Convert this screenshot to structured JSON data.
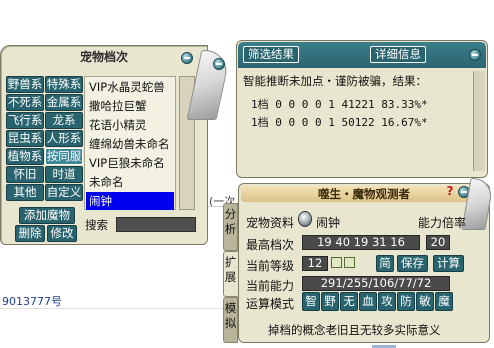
{
  "background": {
    "fragment_text": "(一次",
    "number_text": "9013777号"
  },
  "pet_archive": {
    "title": "宠物档次",
    "categories": [
      "野兽系",
      "特殊系",
      "不死系",
      "金属系",
      "飞行系",
      "龙系",
      "昆虫系",
      "人形系",
      "植物系",
      "按同服",
      "怀旧",
      "时道",
      "其他",
      "自定义"
    ],
    "selected_category": "按同服",
    "pets": [
      "VIP水晶灵蛇兽",
      "撒哈拉巨蟹",
      "花语小精灵",
      "缠绵幼兽未命名",
      "VIP巨狼未命名",
      "未命名",
      "闹钟"
    ],
    "selected_pet": "闹钟",
    "add_button": "添加魔物",
    "delete_button": "删除",
    "modify_button": "修改",
    "search_label": "搜索",
    "search_value": ""
  },
  "results": {
    "filter_button": "筛选结果",
    "detail_button": "详细信息",
    "headline": "智能推断未加点・谨防被骗，结果：",
    "rows": [
      "1档 0 0 0 0 1 41221 83.33%*",
      "1档 0 0 0 0 1 50122 16.67%*"
    ]
  },
  "observer": {
    "title": "噬生・魔物观测者",
    "help_icon": "?",
    "side_tabs": [
      "分析",
      "扩展",
      "模拟"
    ],
    "pet_info_label": "宠物资料",
    "pet_name": "闹钟",
    "ability_multiplier_label": "能力倍率",
    "top_grade_label": "最高档次",
    "top_grade_value": "19 40 19 31 16",
    "top_grade_extra": "20",
    "level_label": "当前等级",
    "level_value": "12",
    "simple_button": "简",
    "save_button": "保存",
    "calc_button": "计算",
    "ability_label": "当前能力",
    "ability_value": "291/255/106/77/72",
    "mode_label": "运算模式",
    "mode_buttons": [
      "智",
      "野",
      "无",
      "血",
      "攻",
      "防",
      "敏",
      "魔"
    ],
    "footer_text": "掉档的概念老旧且无较多实际意义"
  }
}
